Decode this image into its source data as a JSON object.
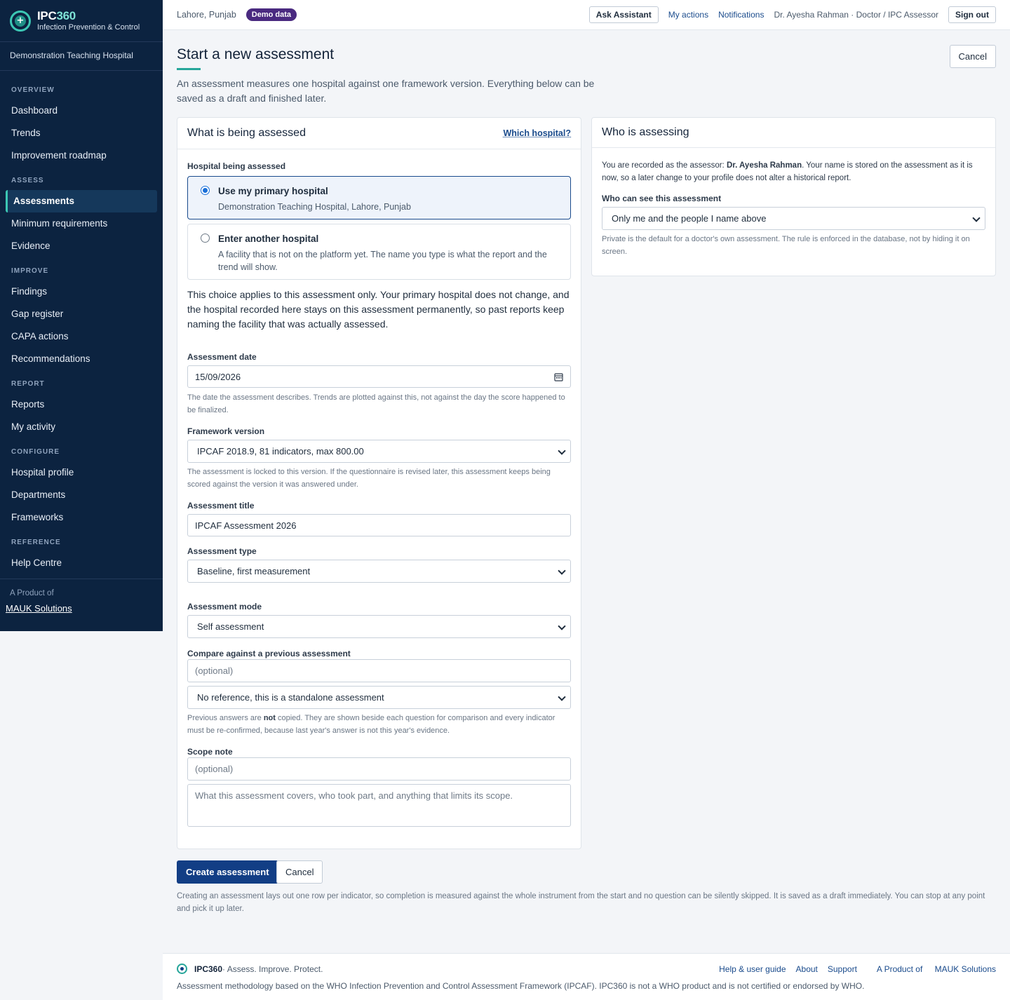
{
  "brand": {
    "name_prefix": "IPC",
    "name_suffix": "360",
    "subtitle": "Infection Prevention & Control"
  },
  "sidebar": {
    "hospital": "Demonstration Teaching Hospital",
    "sections": [
      {
        "title": "OVERVIEW",
        "items": [
          "Dashboard",
          "Trends",
          "Improvement roadmap"
        ]
      },
      {
        "title": "ASSESS",
        "items": [
          "Assessments",
          "Minimum requirements",
          "Evidence"
        ]
      },
      {
        "title": "IMPROVE",
        "items": [
          "Findings",
          "Gap register",
          "CAPA actions",
          "Recommendations"
        ]
      },
      {
        "title": "REPORT",
        "items": [
          "Reports",
          "My activity"
        ]
      },
      {
        "title": "CONFIGURE",
        "items": [
          "Hospital profile",
          "Departments",
          "Frameworks"
        ]
      },
      {
        "title": "REFERENCE",
        "items": [
          "Help Centre"
        ]
      }
    ],
    "active_item": "Assessments",
    "product_of": "A Product of",
    "product_link": "MAUK Solutions"
  },
  "topbar": {
    "location": "Lahore, Punjab",
    "demo_badge": "Demo data",
    "ask_assistant": "Ask Assistant",
    "my_actions": "My actions",
    "notifications": "Notifications",
    "user": "Dr. Ayesha Rahman · Doctor / IPC Assessor",
    "sign_out": "Sign out"
  },
  "page": {
    "title": "Start a new assessment",
    "cancel": "Cancel",
    "intro": "An assessment measures one hospital against one framework version. Everything below can be saved as a draft and finished later."
  },
  "assessed": {
    "heading": "What is being assessed",
    "which_hospital_link": "Which hospital?",
    "hospital_label": "Hospital being assessed",
    "option_primary_title": "Use my primary hospital",
    "option_primary_desc": "Demonstration Teaching Hospital, Lahore, Punjab",
    "option_other_title": "Enter another hospital",
    "option_other_desc": "A facility that is not on the platform yet. The name you type is what the report and the trend will show.",
    "choice_note": "This choice applies to this assessment only. Your primary hospital does not change, and the hospital recorded here stays on this assessment permanently, so past reports keep naming the facility that was actually assessed.",
    "date_label": "Assessment date",
    "date_value": "15/09/2026",
    "date_help": "The date the assessment describes. Trends are plotted against this, not against the day the score happened to be finalized.",
    "framework_label": "Framework version",
    "framework_value": "IPCAF 2018.9, 81 indicators, max 800.00",
    "framework_help": "The assessment is locked to this version. If the questionnaire is revised later, this assessment keeps being scored against the version it was answered under.",
    "title_label": "Assessment title",
    "title_value": "IPCAF Assessment 2026",
    "type_label": "Assessment type",
    "type_value": "Baseline, first measurement",
    "mode_label": "Assessment mode",
    "mode_value": "Self assessment",
    "compare_label": "Compare against a previous assessment",
    "compare_placeholder": "(optional)",
    "compare_value": "No reference, this is a standalone assessment",
    "compare_help_pre": "Previous answers are ",
    "compare_help_bold": "not",
    "compare_help_post": " copied. They are shown beside each question for comparison and every indicator must be re-confirmed, because last year's answer is not this year's evidence.",
    "scope_label": "Scope note",
    "scope_placeholder": "(optional)",
    "scope_textarea_placeholder": "What this assessment covers, who took part, and anything that limits its scope."
  },
  "assessing": {
    "heading": "Who is assessing",
    "recorded_pre": "You are recorded as the assessor: ",
    "recorded_name": "Dr. Ayesha Rahman",
    "recorded_post": ". Your name is stored on the assessment as it is now, so a later change to your profile does not alter a historical report.",
    "visibility_label": "Who can see this assessment",
    "visibility_value": "Only me and the people I name above",
    "visibility_help": "Private is the default for a doctor's own assessment. The rule is enforced in the database, not by hiding it on screen."
  },
  "actions": {
    "create": "Create assessment",
    "cancel": "Cancel",
    "note": "Creating an assessment lays out one row per indicator, so completion is measured against the whole instrument from the start and no question can be silently skipped. It is saved as a draft immediately. You can stop at any point and pick it up later."
  },
  "footer": {
    "brand": "IPC360",
    "tagline": " · Assess. Improve. Protect.",
    "links": [
      "Help & user guide",
      "About",
      "Support"
    ],
    "product_of": "A Product of ",
    "product_link": "MAUK Solutions",
    "disclaimer": "Assessment methodology based on the WHO Infection Prevention and Control Assessment Framework (IPCAF). IPC360 is not a WHO product and is not certified or endorsed by WHO."
  },
  "colors": {
    "sidebar_bg": "#0c2340",
    "accent": "#26a69a",
    "primary_button": "#123e85",
    "demo_badge": "#4a2a80",
    "link": "#1a4b8c"
  },
  "icons": {
    "logo": "ipc360-logo-icon",
    "date_field": "calendar-icon",
    "select": "chevron-down-icon"
  }
}
